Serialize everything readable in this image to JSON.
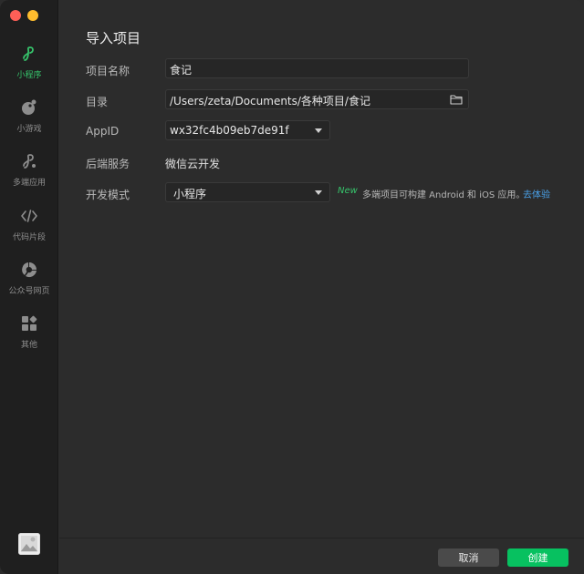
{
  "sidebar": {
    "items": [
      {
        "label": "小程序",
        "icon": "miniprogram-icon",
        "active": true
      },
      {
        "label": "小游戏",
        "icon": "minigame-icon"
      },
      {
        "label": "多端应用",
        "icon": "multiplatform-icon"
      },
      {
        "label": "代码片段",
        "icon": "code-snippet-icon"
      },
      {
        "label": "公众号网页",
        "icon": "official-account-icon"
      },
      {
        "label": "其他",
        "icon": "other-grid-icon"
      }
    ]
  },
  "main": {
    "title": "导入项目",
    "form": {
      "project_name_label": "项目名称",
      "project_name_value": "食记",
      "directory_label": "目录",
      "directory_value": "/Users/zeta/Documents/各种项目/食记",
      "appid_label": "AppID",
      "appid_value": "wx32fc4b09eb7de91f",
      "backend_label": "后端服务",
      "backend_value": "微信云开发",
      "mode_label": "开发模式",
      "mode_value": "小程序",
      "new_tag": "New",
      "mode_hint": "多端项目可构建 Android 和 iOS 应用。",
      "try_link": "去体验"
    },
    "footer": {
      "cancel_label": "取消",
      "create_label": "创建"
    }
  },
  "colors": {
    "accent_green": "#07c160",
    "link_blue": "#4aa2ea",
    "close_red": "#fe5f57",
    "minimize_yellow": "#febc2e"
  }
}
